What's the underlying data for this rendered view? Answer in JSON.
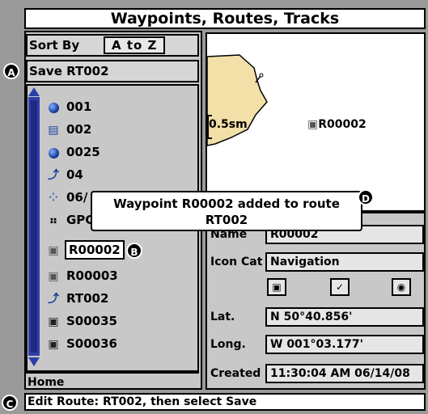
{
  "window": {
    "title": "Waypoints, Routes, Tracks"
  },
  "sort": {
    "label": "Sort By",
    "value": "A to Z"
  },
  "save": {
    "label": "Save RT002"
  },
  "list": {
    "items": [
      {
        "label": "001",
        "icon": "waypoint-dot-icon"
      },
      {
        "label": "002",
        "icon": "list-icon"
      },
      {
        "label": "0025",
        "icon": "waypoint-dot-icon"
      },
      {
        "label": "04",
        "icon": "route-icon"
      },
      {
        "label": "06/",
        "icon": "track-icon"
      },
      {
        "label": "GPC",
        "icon": "grid-icon"
      },
      {
        "label": "R00002",
        "icon": "camera-icon",
        "selected": true
      },
      {
        "label": "R00003",
        "icon": "camera-icon"
      },
      {
        "label": "RT002",
        "icon": "route-icon"
      },
      {
        "label": "S00035",
        "icon": "camera-icon"
      },
      {
        "label": "S00036",
        "icon": "camera-icon"
      }
    ],
    "home": "Home"
  },
  "map": {
    "scale": "0.5sm",
    "waypoint": "R00002"
  },
  "details": {
    "name_label": "Name",
    "name_value": "R00002",
    "icon_cat_label": "Icon Cat",
    "icon_cat_value": "Navigation",
    "lat_label": "Lat.",
    "lat_value": "N 50°40.856'",
    "long_label": "Long.",
    "long_value": "W 001°03.177'",
    "created_label": "Created",
    "created_value": "11:30:04 AM 06/14/08"
  },
  "popup": {
    "line1": "Waypoint R00002 added to route",
    "line2": "RT002"
  },
  "status": {
    "text": "Edit Route: RT002, then select Save"
  },
  "callouts": {
    "a": "A",
    "b": "B",
    "c": "C",
    "d": "D"
  },
  "colors": {
    "accent": "#2e3ea8",
    "land": "#f2e0a8"
  }
}
